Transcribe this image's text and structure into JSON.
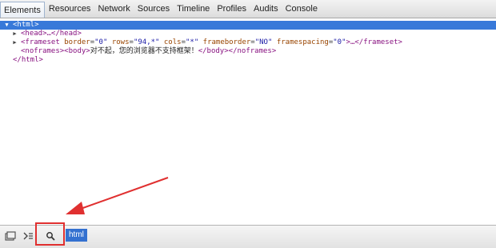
{
  "tabs": [
    {
      "label": "Elements",
      "active": true
    },
    {
      "label": "Resources",
      "active": false
    },
    {
      "label": "Network",
      "active": false
    },
    {
      "label": "Sources",
      "active": false
    },
    {
      "label": "Timeline",
      "active": false
    },
    {
      "label": "Profiles",
      "active": false
    },
    {
      "label": "Audits",
      "active": false
    },
    {
      "label": "Console",
      "active": false
    }
  ],
  "dom": {
    "html_open": "<html>",
    "head": "<head>…</head>",
    "frameset_open": "<frameset",
    "frameset_border_attr": "border",
    "frameset_border_val": "\"0\"",
    "frameset_rows_attr": "rows",
    "frameset_rows_val": "\"94,*\"",
    "frameset_cols_attr": "cols",
    "frameset_cols_val": "\"*\"",
    "frameset_frameborder_attr": "frameborder",
    "frameset_frameborder_val": "\"NO\"",
    "frameset_framespacing_attr": "framespacing",
    "frameset_framespacing_val": "\"0\"",
    "frameset_close": ">…</frameset>",
    "noframes_open": "<noframes><body>",
    "noframes_text": "对不起，您的浏览器不支持框架！",
    "noframes_close": "</body></noframes>",
    "html_close": "</html>"
  },
  "statusbar": {
    "dock_icon": "dock-icon",
    "console_toggle_icon": "console-toggle-icon",
    "inspect_icon": "magnifier-icon",
    "breadcrumb": "html"
  },
  "annotation": {
    "arrow_color": "#e03030",
    "box_color": "#e03030"
  }
}
